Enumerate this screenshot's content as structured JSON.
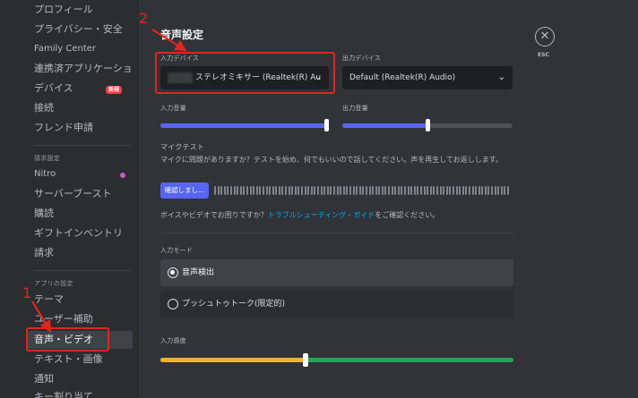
{
  "sidebar": {
    "items_top": [
      {
        "label": "プロフィール"
      },
      {
        "label": "プライバシー・安全"
      },
      {
        "label": "Family Center"
      },
      {
        "label": "連携済アプリケーショ..."
      },
      {
        "label": "デバイス"
      },
      {
        "label": "接続"
      },
      {
        "label": "フレンド申請"
      }
    ],
    "new_badge": "新規",
    "billing_header": "請求設定",
    "items_billing": [
      {
        "label": "Nitro"
      },
      {
        "label": "サーバーブースト"
      },
      {
        "label": "購読"
      },
      {
        "label": "ギフトインベントリ"
      },
      {
        "label": "請求"
      }
    ],
    "app_header": "アプリの設定",
    "items_app": [
      {
        "label": "テーマ"
      },
      {
        "label": "ユーザー補助"
      },
      {
        "label": "音声・ビデオ"
      },
      {
        "label": "テキスト・画像"
      },
      {
        "label": "通知"
      },
      {
        "label": "キー割り当て"
      }
    ]
  },
  "main": {
    "title": "音声設定",
    "input_device_label": "入力デバイス",
    "input_device_value": "ステレオミキサー (Realtek(R) Au",
    "output_device_label": "出力デバイス",
    "output_device_value": "Default (Realtek(R) Audio)",
    "input_volume_label": "入力音量",
    "input_volume": 1.0,
    "output_volume_label": "出力音量",
    "output_volume": 0.5,
    "mic_test_label": "マイクテスト",
    "mic_test_desc": "マイクに問題がありますか？テストを始め、何でもいいので話してください。声を再生してお返しします。",
    "check_button": "確認しまし...",
    "help_prefix": "ボイスやビデオでお困りですか？",
    "help_link": "トラブルシューティング・ガイド",
    "help_suffix": "をご確認ください。",
    "input_mode_label": "入力モード",
    "mode_voice": "音声検出",
    "mode_ptt": "プッシュトゥトーク(限定的)",
    "sensitivity_label": "入力感度",
    "sensitivity": 0.41,
    "esc_label": "ESC"
  },
  "annotations": {
    "step1": "1",
    "step2": "2"
  },
  "colors": {
    "accent": "#5865f2",
    "annotation": "#e0261c",
    "link": "#00a8fc",
    "sensitivity_yellow": "#f0b232",
    "sensitivity_green": "#23a55a"
  }
}
